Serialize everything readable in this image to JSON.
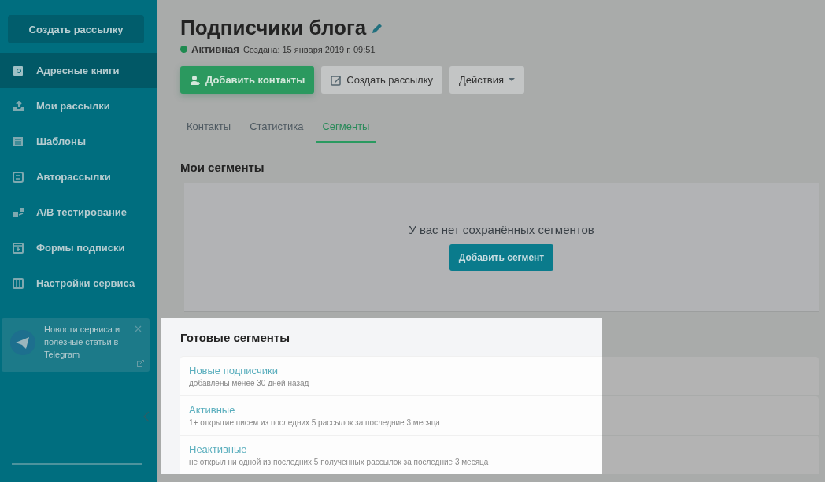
{
  "sidebar": {
    "create_button": "Создать рассылку",
    "items": [
      {
        "label": "Адресные книги",
        "selected": true
      },
      {
        "label": "Мои рассылки",
        "selected": false
      },
      {
        "label": "Шаблоны",
        "selected": false
      },
      {
        "label": "Авторассылки",
        "selected": false
      },
      {
        "label": "A/B тестирование",
        "selected": false
      },
      {
        "label": "Формы подписки",
        "selected": false
      },
      {
        "label": "Настройки сервиса",
        "selected": false
      }
    ],
    "promo": {
      "text": "Новости сервиса и полезные статьи в Telegram"
    }
  },
  "header": {
    "title": "Подписчики блога",
    "status": "Активная",
    "created": "Создана: 15 января 2019 г. 09:51"
  },
  "actions": [
    {
      "label": "Добавить контакты",
      "kind": "primary"
    },
    {
      "label": "Создать рассылку",
      "kind": "edit"
    },
    {
      "label": "Действия",
      "kind": "dropdown"
    }
  ],
  "tabs": [
    {
      "label": "Контакты",
      "selected": false
    },
    {
      "label": "Статистика",
      "selected": false
    },
    {
      "label": "Сегменты",
      "selected": true
    }
  ],
  "my_segments": {
    "title": "Мои сегменты",
    "empty_text": "У вас нет сохранённых сегментов",
    "add_button": "Добавить сегмент"
  },
  "ready_segments": {
    "title": "Готовые сегменты",
    "items": [
      {
        "name": "Новые подписчики",
        "description": "добавлены менее 30 дней назад"
      },
      {
        "name": "Активные",
        "description": "1+ открытие писем из последних 5 рассылок за последние 3 месяца"
      },
      {
        "name": "Неактивные",
        "description": "не открыл ни одной из последних 5 полученных рассылок за последние 3 месяца"
      }
    ]
  }
}
